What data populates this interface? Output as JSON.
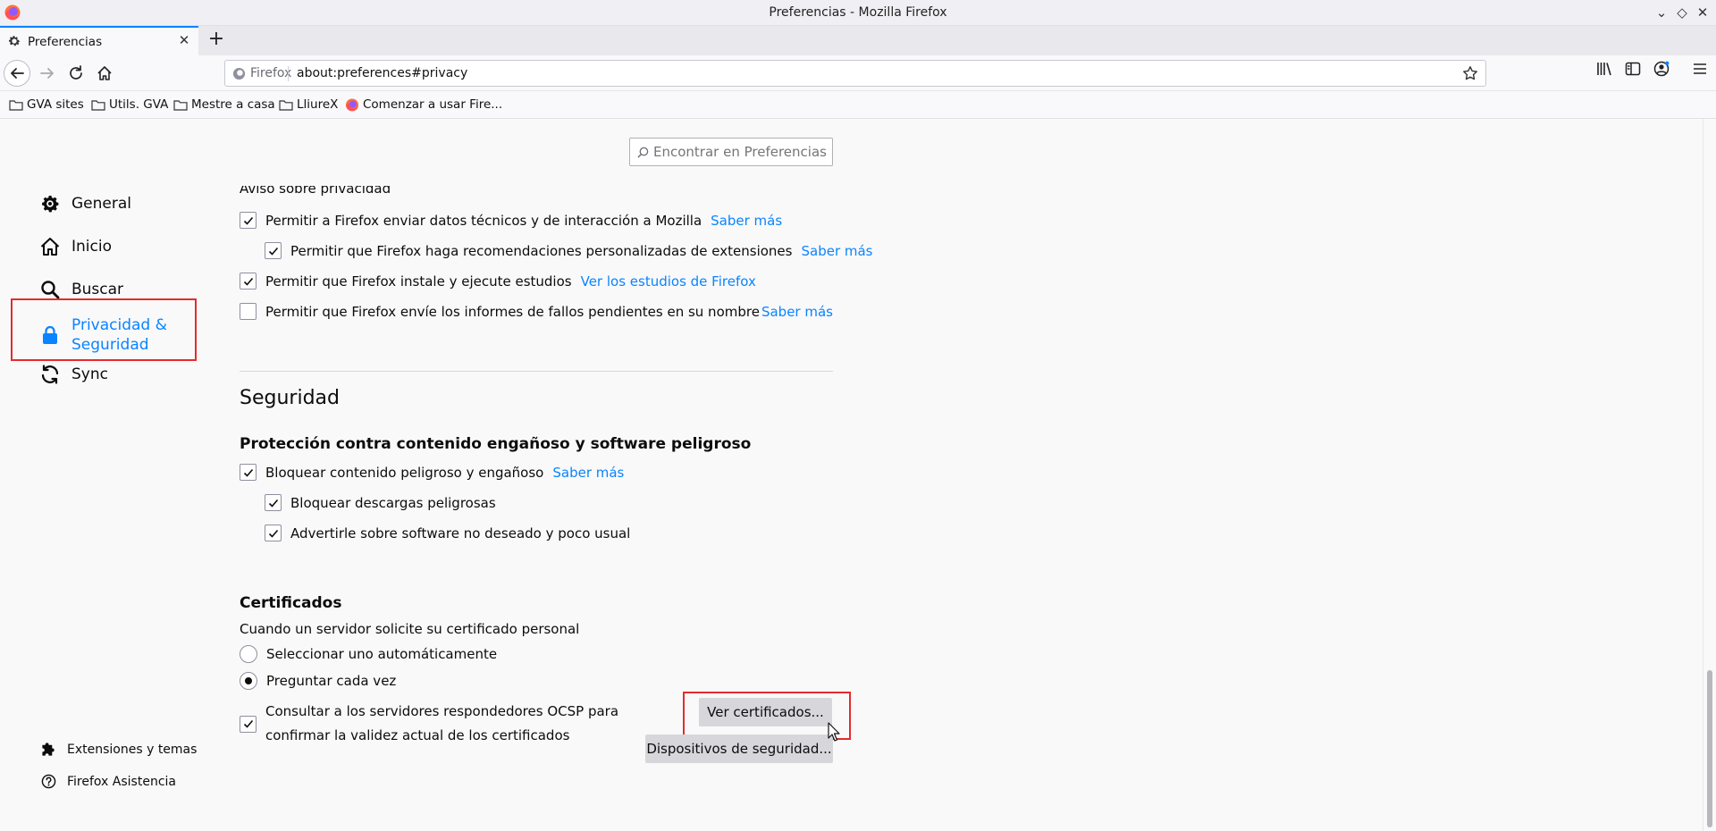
{
  "window": {
    "title": "Preferencias - Mozilla Firefox"
  },
  "tab": {
    "label": "Preferencias"
  },
  "urlbar": {
    "identity_label": "Firefox",
    "url": "about:preferences#privacy"
  },
  "bookmarks": [
    {
      "label": "GVA sites"
    },
    {
      "label": "Utils. GVA"
    },
    {
      "label": "Mestre a casa"
    },
    {
      "label": "LliureX"
    },
    {
      "label": "Comenzar a usar Fire..."
    }
  ],
  "search": {
    "placeholder": "Encontrar en Preferencias"
  },
  "sidebar": {
    "items": [
      {
        "label": "General",
        "icon": "gear-icon"
      },
      {
        "label": "Inicio",
        "icon": "home-icon"
      },
      {
        "label": "Buscar",
        "icon": "search-icon"
      },
      {
        "label_line1": "Privacidad &",
        "label_line2": "Seguridad",
        "icon": "lock-icon",
        "active": true
      },
      {
        "label": "Sync",
        "icon": "sync-icon"
      }
    ],
    "footer": {
      "extensions": "Extensiones y temas",
      "support": "Firefox Asistencia"
    }
  },
  "data_collection": {
    "privacy_notice": "Aviso sobre privacidad",
    "options": [
      {
        "label": "Permitir a Firefox enviar datos técnicos y de interacción a Mozilla",
        "checked": true,
        "link": "Saber más"
      },
      {
        "label": "Permitir que Firefox haga recomendaciones personalizadas de extensiones",
        "checked": true,
        "link": "Saber más"
      },
      {
        "label": "Permitir que Firefox instale y ejecute estudios",
        "checked": true,
        "link": "Ver los estudios de Firefox"
      },
      {
        "label": "Permitir que Firefox envíe los informes de fallos pendientes en su nombre",
        "checked": false,
        "link": "Saber más"
      }
    ]
  },
  "security": {
    "title": "Seguridad",
    "deceptive_title": "Protección contra contenido engañoso y software peligroso",
    "options": [
      {
        "label": "Bloquear contenido peligroso y engañoso",
        "checked": true,
        "link": "Saber más"
      },
      {
        "label": "Bloquear descargas peligrosas",
        "checked": true
      },
      {
        "label": "Advertirle sobre software no deseado y poco usual",
        "checked": true
      }
    ]
  },
  "certificates": {
    "title": "Certificados",
    "prompt": "Cuando un servidor solicite su certificado personal",
    "radios": [
      {
        "label": "Seleccionar uno automáticamente",
        "selected": false
      },
      {
        "label": "Preguntar cada vez",
        "selected": true
      }
    ],
    "ocsp_line1": "Consultar a los servidores respondedores OCSP para",
    "ocsp_line2": "confirmar la validez actual de los certificados",
    "ocsp_checked": true,
    "view_button": "Ver certificados...",
    "devices_button": "Dispositivos de seguridad..."
  },
  "colors": {
    "accent": "#0a84ff",
    "highlight": "#e52b2b"
  }
}
